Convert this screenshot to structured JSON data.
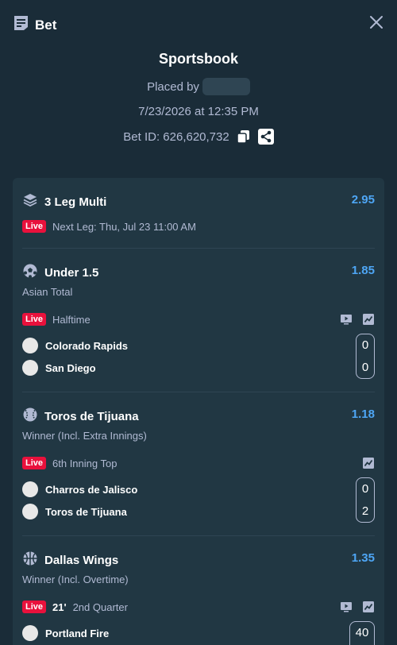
{
  "header": {
    "title": "Bet",
    "icon": "receipt-icon",
    "close_icon": "close-icon"
  },
  "info": {
    "title": "Sportsbook",
    "placed_by_label": "Placed by",
    "datetime": "7/23/2026 at 12:35 PM",
    "bet_id_label": "Bet ID: 626,620,732"
  },
  "colors": {
    "background": "#1a2c38",
    "card": "#213743",
    "odds": "#4ea6f5",
    "live": "#e9113c",
    "muted": "#b1bad3"
  },
  "multi": {
    "title": "3 Leg Multi",
    "odds": "2.95",
    "live_label": "Live",
    "next_leg": "Next Leg: Thu, Jul 23 11:00 AM"
  },
  "legs": [
    {
      "title": "Under 1.5",
      "odds": "1.85",
      "market": "Asian Total",
      "live_label": "Live",
      "status": "Halftime",
      "sport_icon": "soccer-ball-icon",
      "teams": [
        {
          "name": "Colorado Rapids",
          "score": "0"
        },
        {
          "name": "San Diego",
          "score": "0"
        }
      ]
    },
    {
      "title": "Toros de Tijuana",
      "odds": "1.18",
      "market": "Winner (Incl. Extra Innings)",
      "live_label": "Live",
      "status": "6th Inning Top",
      "sport_icon": "baseball-icon",
      "teams": [
        {
          "name": "Charros de Jalisco",
          "score": "0"
        },
        {
          "name": "Toros de Tijuana",
          "score": "2"
        }
      ]
    },
    {
      "title": "Dallas Wings",
      "odds": "1.35",
      "market": "Winner (Incl. Overtime)",
      "live_label": "Live",
      "clock": "21'",
      "status": "2nd Quarter",
      "sport_icon": "basketball-icon",
      "teams": [
        {
          "name": "Portland Fire",
          "score": "40"
        }
      ]
    }
  ]
}
